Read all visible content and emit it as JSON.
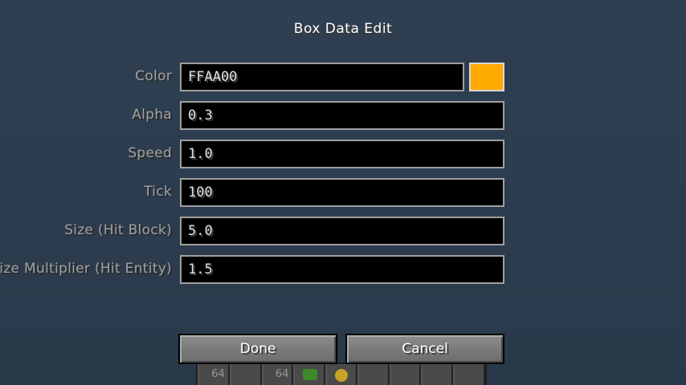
{
  "dialog": {
    "title": "Box Data Edit"
  },
  "fields": [
    {
      "label": "Color",
      "value": "FFAA00"
    },
    {
      "label": "Alpha",
      "value": "0.3"
    },
    {
      "label": "Speed",
      "value": "1.0"
    },
    {
      "label": "Tick",
      "value": "100"
    },
    {
      "label": "Size (Hit Block)",
      "value": "5.0"
    },
    {
      "label": "Size Multiplier (Hit Entity)",
      "value": "1.5"
    }
  ],
  "color_swatch": {
    "color": "#FFAA00"
  },
  "buttons": {
    "done": "Done",
    "cancel": "Cancel"
  },
  "hotbar": {
    "slots": [
      "64",
      "",
      "64",
      "",
      "",
      "",
      "",
      "",
      ""
    ]
  }
}
